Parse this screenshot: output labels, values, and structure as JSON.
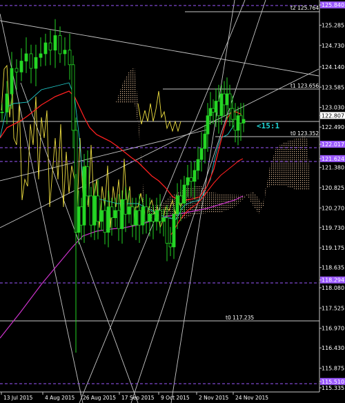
{
  "chart_data": {
    "type": "line",
    "price_axis": {
      "labels": [
        "125.840",
        "125.285",
        "124.730",
        "124.140",
        "123.585",
        "123.030",
        "122.807",
        "122.490",
        "122.017",
        "121.624",
        "121.380",
        "120.825",
        "120.270",
        "119.730",
        "119.175",
        "118.635",
        "118.294",
        "118.080",
        "117.525",
        "116.970",
        "116.430",
        "115.875",
        "115.510",
        "115.335"
      ],
      "highlight": {
        "125.840": "#9b59ff",
        "122.017": "#9b59ff",
        "121.624": "#9b59ff",
        "118.294": "#9b59ff",
        "115.510": "#9b59ff"
      },
      "current": "122.807",
      "ylim": [
        115.335,
        125.9
      ]
    },
    "time_axis": [
      "13 Jul 2015",
      "4 Aug 2015",
      "26 Aug 2015",
      "17 Sep 2015",
      "9 Oct 2015",
      "2 Nov 2015",
      "24 Nov 2015"
    ],
    "annotations": [
      {
        "text": "t2  125.764",
        "color": "#aaaaaa"
      },
      {
        "text": "t1  123.656",
        "color": "#aaaaaa"
      },
      {
        "text": "t0  123.352",
        "color": "#aaaaaa"
      },
      {
        "text": "t0  117.235",
        "color": "#aaaaaa"
      },
      {
        "text": "<15:1",
        "color": "#1fd3d3"
      }
    ],
    "dashed_levels": [
      125.84,
      122.017,
      121.624,
      118.294,
      115.51
    ],
    "colors": {
      "bull": "#25d625",
      "bear": "#c8ffc8",
      "ma_fast": "#ff2020",
      "ma_slow": "#cc33cc",
      "oscillator": "#f0e040",
      "cloud": "#f0c8a0",
      "cyan": "#20c8c8"
    }
  },
  "labels": {
    "p0": "125.840",
    "p1": "125.285",
    "p2": "124.730",
    "p3": "124.140",
    "p4": "123.585",
    "p5": "123.030",
    "p6": "122.807",
    "p7": "122.490",
    "p8": "122.017",
    "p9": "121.624",
    "p10": "121.380",
    "p11": "120.825",
    "p12": "120.270",
    "p13": "119.730",
    "p14": "119.175",
    "p15": "118.635",
    "p16": "118.294",
    "p17": "118.080",
    "p18": "117.525",
    "p19": "116.970",
    "p20": "116.430",
    "p21": "115.875",
    "p22": "115.510",
    "p23": "115.335",
    "t0": "13 Jul 2015",
    "t1": "4 Aug 2015",
    "t2": "26 Aug 2015",
    "t3": "17 Sep 2015",
    "t4": "9 Oct 2015",
    "t5": "2 Nov 2015",
    "t6": "24 Nov 2015",
    "a_t2": "t2  125.764",
    "a_t1": "t1  123.656",
    "a_t0a": "t0  123.352",
    "a_t0b": "t0  117.235",
    "ratio": "<15:1"
  }
}
